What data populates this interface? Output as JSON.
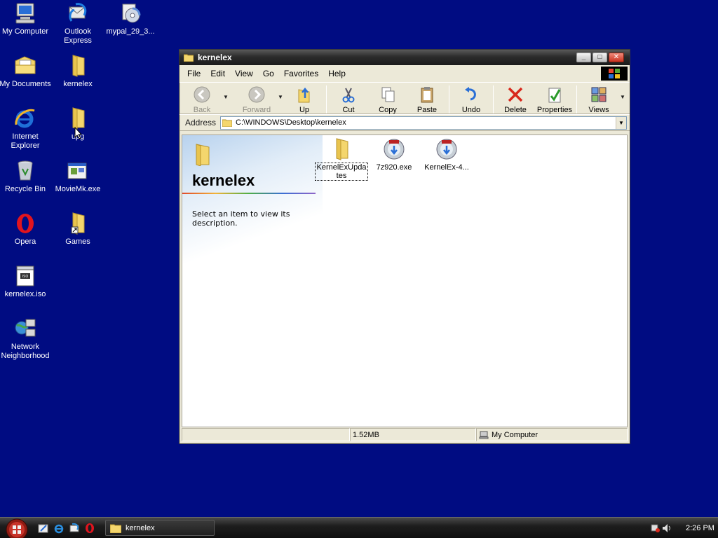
{
  "desktop": {
    "icons": [
      {
        "label": "My Computer"
      },
      {
        "label": "Outlook Express"
      },
      {
        "label": "mypal_29_3..."
      },
      {
        "label": "My Documents"
      },
      {
        "label": "kernelex"
      },
      {
        "label": "Internet Explorer"
      },
      {
        "label": "upg"
      },
      {
        "label": "Recycle Bin"
      },
      {
        "label": "MovieMk.exe"
      },
      {
        "label": "Opera"
      },
      {
        "label": "Games"
      },
      {
        "label": "kernelex.iso"
      },
      {
        "label": "Network Neighborhood"
      }
    ]
  },
  "window": {
    "title": "kernelex",
    "controls": {
      "minimize": "_",
      "maximize": "□",
      "close": "✕"
    },
    "menu": [
      {
        "label": "File"
      },
      {
        "label": "Edit"
      },
      {
        "label": "View"
      },
      {
        "label": "Go"
      },
      {
        "label": "Favorites"
      },
      {
        "label": "Help"
      }
    ],
    "toolbar": {
      "back": "Back",
      "forward": "Forward",
      "up": "Up",
      "cut": "Cut",
      "copy": "Copy",
      "paste": "Paste",
      "undo": "Undo",
      "delete": "Delete",
      "properties": "Properties",
      "views": "Views"
    },
    "address": {
      "label": "Address",
      "value": "C:\\WINDOWS\\Desktop\\kernelex"
    },
    "webview": {
      "title": "kernelex",
      "description": "Select an item to view its description."
    },
    "files": [
      {
        "label": "KernelExUpdates"
      },
      {
        "label": "7z920.exe"
      },
      {
        "label": "KernelEx-4..."
      }
    ],
    "status": {
      "size": "1.52MB",
      "zone": "My Computer"
    }
  },
  "taskbar": {
    "task_label": "kernelex",
    "clock": "2:26 PM"
  },
  "colors": {
    "desktop": "#000c82",
    "window_face": "#ece9d8",
    "titlebar": "#2c2c2c",
    "taskbar": "#1e1e1e"
  }
}
